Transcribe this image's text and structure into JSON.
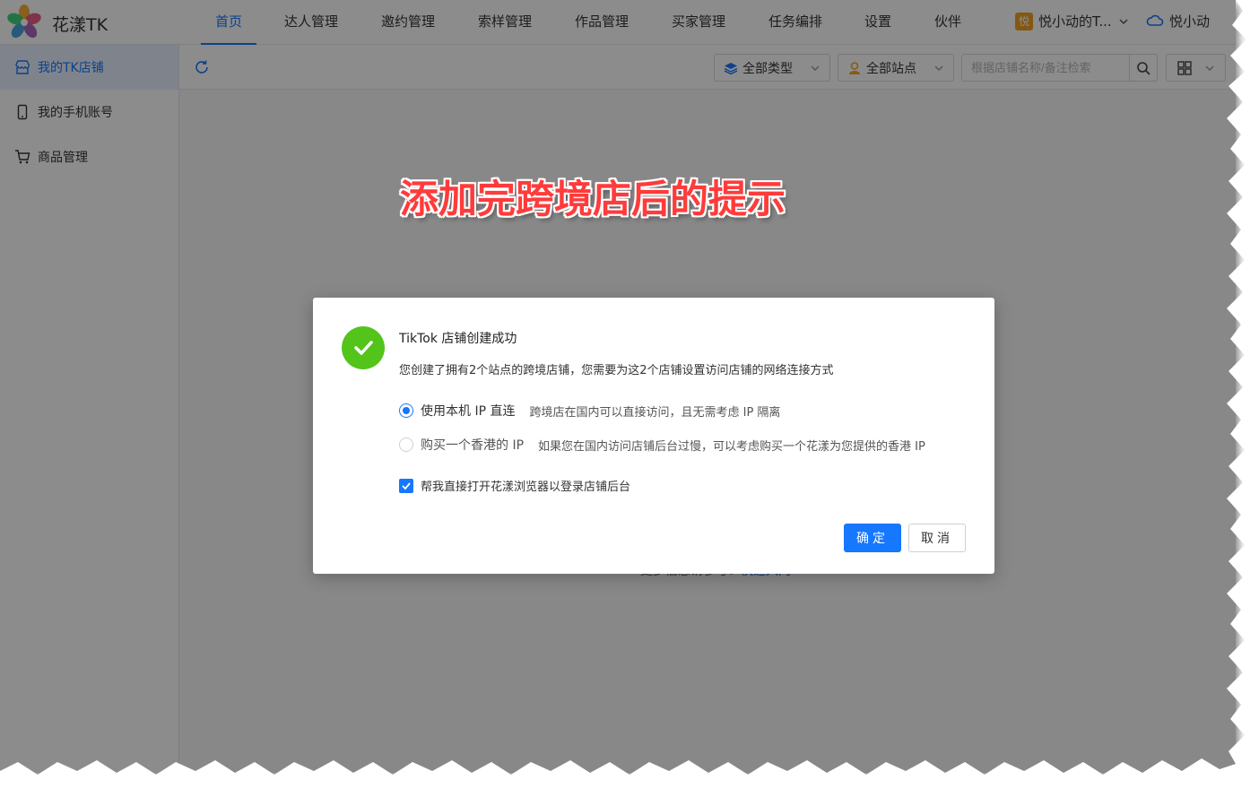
{
  "app": {
    "brand": "花漾TK"
  },
  "nav": {
    "items": [
      {
        "label": "首页",
        "active": true
      },
      {
        "label": "达人管理"
      },
      {
        "label": "邀约管理"
      },
      {
        "label": "索样管理"
      },
      {
        "label": "作品管理"
      },
      {
        "label": "买家管理"
      },
      {
        "label": "任务编排"
      },
      {
        "label": "设置"
      },
      {
        "label": "伙伴"
      }
    ],
    "team_badge": "悦",
    "team_name": "悦小动的T...",
    "user_name": "悦小动"
  },
  "sidebar": {
    "items": [
      {
        "label": "我的TK店铺",
        "icon": "shop-icon",
        "active": true
      },
      {
        "label": "我的手机账号",
        "icon": "phone-icon"
      },
      {
        "label": "商品管理",
        "icon": "cart-icon"
      }
    ]
  },
  "toolbar": {
    "type_filter": "全部类型",
    "site_filter": "全部站点",
    "search_placeholder": "根据店铺名称/备注检索"
  },
  "background": {
    "hint_text": "更多信息请参考：",
    "hint_link": "快速入门"
  },
  "caption": "添加完跨境店后的提示",
  "dialog": {
    "title": "TikTok 店铺创建成功",
    "description": "您创建了拥有2个站点的跨境店铺，您需要为这2个店铺设置访问店铺的网络连接方式",
    "options": [
      {
        "label": "使用本机 IP 直连",
        "note": "跨境店在国内可以直接访问，且无需考虑 IP 隔离",
        "selected": true
      },
      {
        "label": "购买一个香港的 IP",
        "note": "如果您在国内访问店铺后台过慢，可以考虑购买一个花漾为您提供的香港 IP",
        "selected": false
      }
    ],
    "checkbox_label": "帮我直接打开花漾浏览器以登录店铺后台",
    "checkbox_checked": true,
    "ok_label": "确定",
    "cancel_label": "取消"
  },
  "colors": {
    "primary": "#1677ff",
    "success": "#52c41a",
    "caption": "#ff3b3b"
  }
}
